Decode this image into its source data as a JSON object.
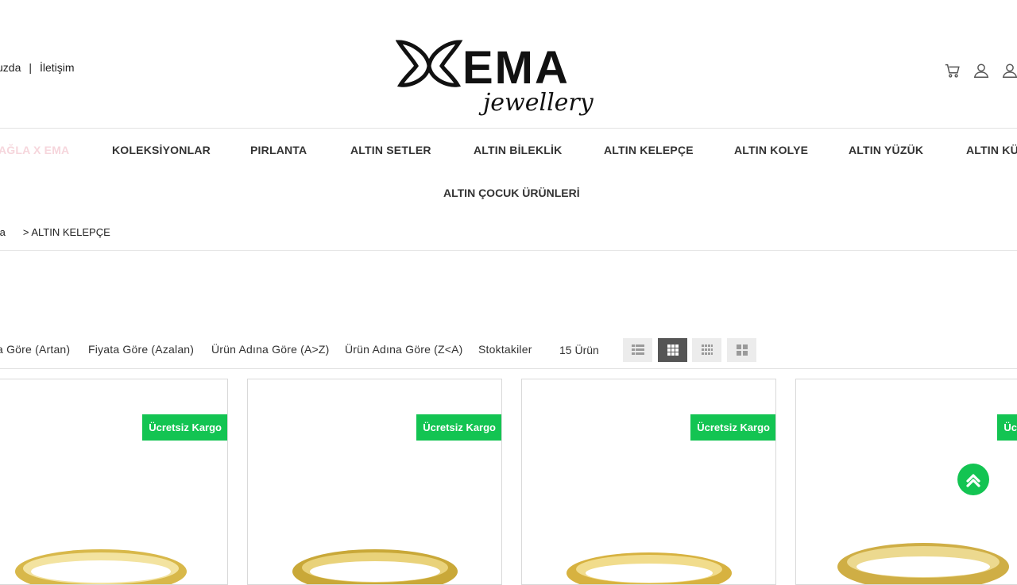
{
  "top_links": {
    "left": "uzda",
    "right": "İletişim"
  },
  "logo": {
    "brand": "EMA",
    "tagline": "jewellery"
  },
  "icons": [
    "cart-icon",
    "user-icon",
    "account-icon"
  ],
  "nav": {
    "items": [
      "AĞLA X EMA",
      "KOLEKSİYONLAR",
      "PIRLANTA",
      "ALTIN SETLER",
      "ALTIN BİLEKLİK",
      "ALTIN KELEPÇE",
      "ALTIN KOLYE",
      "ALTIN YÜZÜK",
      "ALTIN KÜ"
    ],
    "row2": "ALTIN ÇOCUK ÜRÜNLERİ"
  },
  "breadcrumb": {
    "home": "fa",
    "current": "> ALTIN KELEPÇE"
  },
  "sort": {
    "options": [
      "a Göre (Artan)",
      "Fiyata Göre (Azalan)",
      "Ürün Adına Göre (A>Z)",
      "Ürün Adına Göre (Z<A)",
      "Stoktakiler"
    ],
    "count": "15 Ürün"
  },
  "products": [
    {
      "badge": "Ücretsiz Kargo"
    },
    {
      "badge": "Ücretsiz Kargo"
    },
    {
      "badge": "Ücretsiz Kargo"
    },
    {
      "badge": "Ücretsiz "
    }
  ],
  "colors": {
    "accent_green": "#13c452",
    "active_view": "#555555",
    "faded_nav": "#f6d6dc"
  }
}
